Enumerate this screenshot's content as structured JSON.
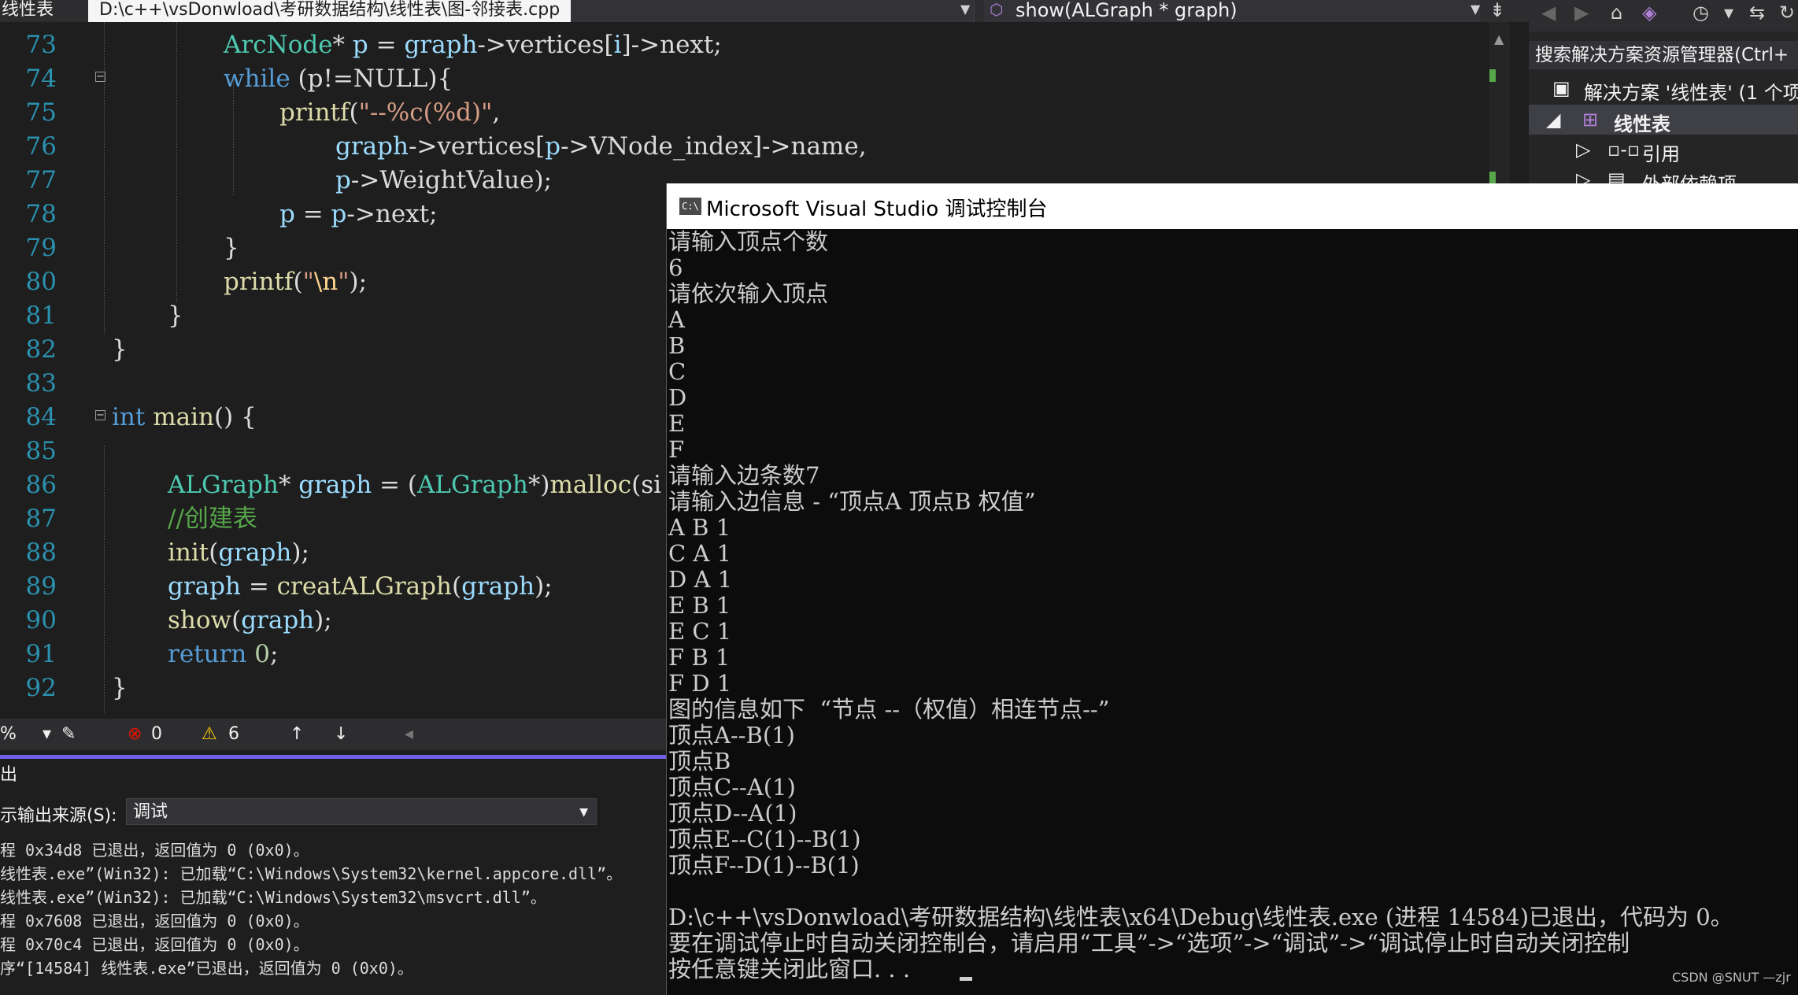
{
  "topbar": {
    "project_label": "线性表",
    "file_path": "D:\\c++\\vsDonwload\\考研数据结构\\线性表\\图-邻接表.cpp",
    "function_scope": "show(ALGraph * graph)"
  },
  "editor": {
    "line_numbers": [
      "73",
      "74",
      "75",
      "76",
      "77",
      "78",
      "79",
      "80",
      "81",
      "82",
      "83",
      "84",
      "85",
      "86",
      "87",
      "88",
      "89",
      "90",
      "91",
      "92"
    ],
    "code": {
      "l73_type": "ArcNode",
      "l73_rest": "* ",
      "l73_var": "p",
      "l73_eq": " = ",
      "l73_graph": "graph",
      "l73_arrow": "->",
      "l73_vertices": "vertices",
      "l73_br1": "[",
      "l73_i": "i",
      "l73_br2": "]->",
      "l73_next": "next;",
      "l74_kw": "while",
      "l74_rest": " (p!=NULL){",
      "l75_fn": "printf",
      "l75_open": "(",
      "l75_str": "\"--%c(%d)\"",
      "l75_comma": ",",
      "l76_graph": "graph",
      "l76_a": "->",
      "l76_vertices": "vertices",
      "l76_b": "[",
      "l76_p": "p",
      "l76_c": "->",
      "l76_idx": "VNode_index",
      "l76_d": "]->",
      "l76_name": "name",
      "l76_e": ",",
      "l77_p": "p",
      "l77_a": "->",
      "l77_w": "WeightValue",
      "l77_b": ");",
      "l78_p": "p",
      "l78_eq": " = ",
      "l78_p2": "p",
      "l78_a": "->",
      "l78_next": "next;",
      "l79": "}",
      "l80_fn": "printf",
      "l80_open": "(",
      "l80_q1": "\"",
      "l80_esc": "\\n",
      "l80_q2": "\"",
      "l80_close": ");",
      "l81": "}",
      "l82": "}",
      "l84_kw": "int",
      "l84_fn": " main",
      "l84_rest": "() {",
      "l86_type": "ALGraph",
      "l86_star": "* ",
      "l86_var": "graph",
      "l86_eq": " = (",
      "l86_type2": "ALGraph",
      "l86_cast": "*)",
      "l86_fn": "malloc",
      "l86_open": "(si",
      "l87_comment": "//创建表",
      "l88_fn": "init",
      "l88_open": "(",
      "l88_var": "graph",
      "l88_close": ");",
      "l89_var": "graph",
      "l89_eq": " = ",
      "l89_fn": "creatALGraph",
      "l89_open": "(",
      "l89_var2": "graph",
      "l89_close": ");",
      "l90_fn": "show",
      "l90_open": "(",
      "l90_var": "graph",
      "l90_close": ");",
      "l91_kw": "return",
      "l91_sp": " ",
      "l91_num": "0",
      "l91_semi": ";",
      "l92": "}"
    }
  },
  "statusbar": {
    "zoom": "%",
    "errors": "0",
    "warnings": "6"
  },
  "output_panel": {
    "title": "出",
    "source_label": "示输出来源(S):",
    "source_value": "调试",
    "lines": [
      "程 0x34d8 已退出，返回值为 0 (0x0)。",
      "线性表.exe”(Win32): 已加载“C:\\Windows\\System32\\kernel.appcore.dll”。",
      "线性表.exe”(Win32): 已加载“C:\\Windows\\System32\\msvcrt.dll”。",
      "程 0x7608 已退出，返回值为 0 (0x0)。",
      "程 0x70c4 已退出，返回值为 0 (0x0)。",
      "序“[14584] 线性表.exe”已退出，返回值为 0 (0x0)。"
    ]
  },
  "solution_explorer": {
    "search": "搜索解决方案资源管理器(Ctrl+",
    "solution": "解决方案 '线性表' (1 个项",
    "project": "线性表",
    "references": "引用",
    "external_deps": "外部依赖项"
  },
  "console": {
    "title": "Microsoft Visual Studio 调试控制台",
    "icon_text": "C:\\",
    "lines": [
      "请输入顶点个数",
      "6",
      "请依次输入顶点",
      "A",
      "B",
      "C",
      "D",
      "E",
      "F",
      "请输入边条数7",
      "请输入边信息 - “顶点A 顶点B 权值”",
      "A B 1",
      "C A 1",
      "D A 1",
      "E B 1",
      "E C 1",
      "F B 1",
      "F D 1",
      "图的信息如下  “节点 --（权值）相连节点--”",
      "顶点A--B(1)",
      "顶点B",
      "顶点C--A(1)",
      "顶点D--A(1)",
      "顶点E--C(1)--B(1)",
      "顶点F--D(1)--B(1)",
      "",
      "D:\\c++\\vsDonwload\\考研数据结构\\线性表\\x64\\Debug\\线性表.exe (进程 14584)已退出，代码为 0。",
      "要在调试停止时自动关闭控制台，请启用“工具”->“选项”->“调试”->“调试停止时自动关闭控制",
      "按任意键关闭此窗口. . ."
    ]
  },
  "watermark": "CSDN @SNUT —zjr"
}
